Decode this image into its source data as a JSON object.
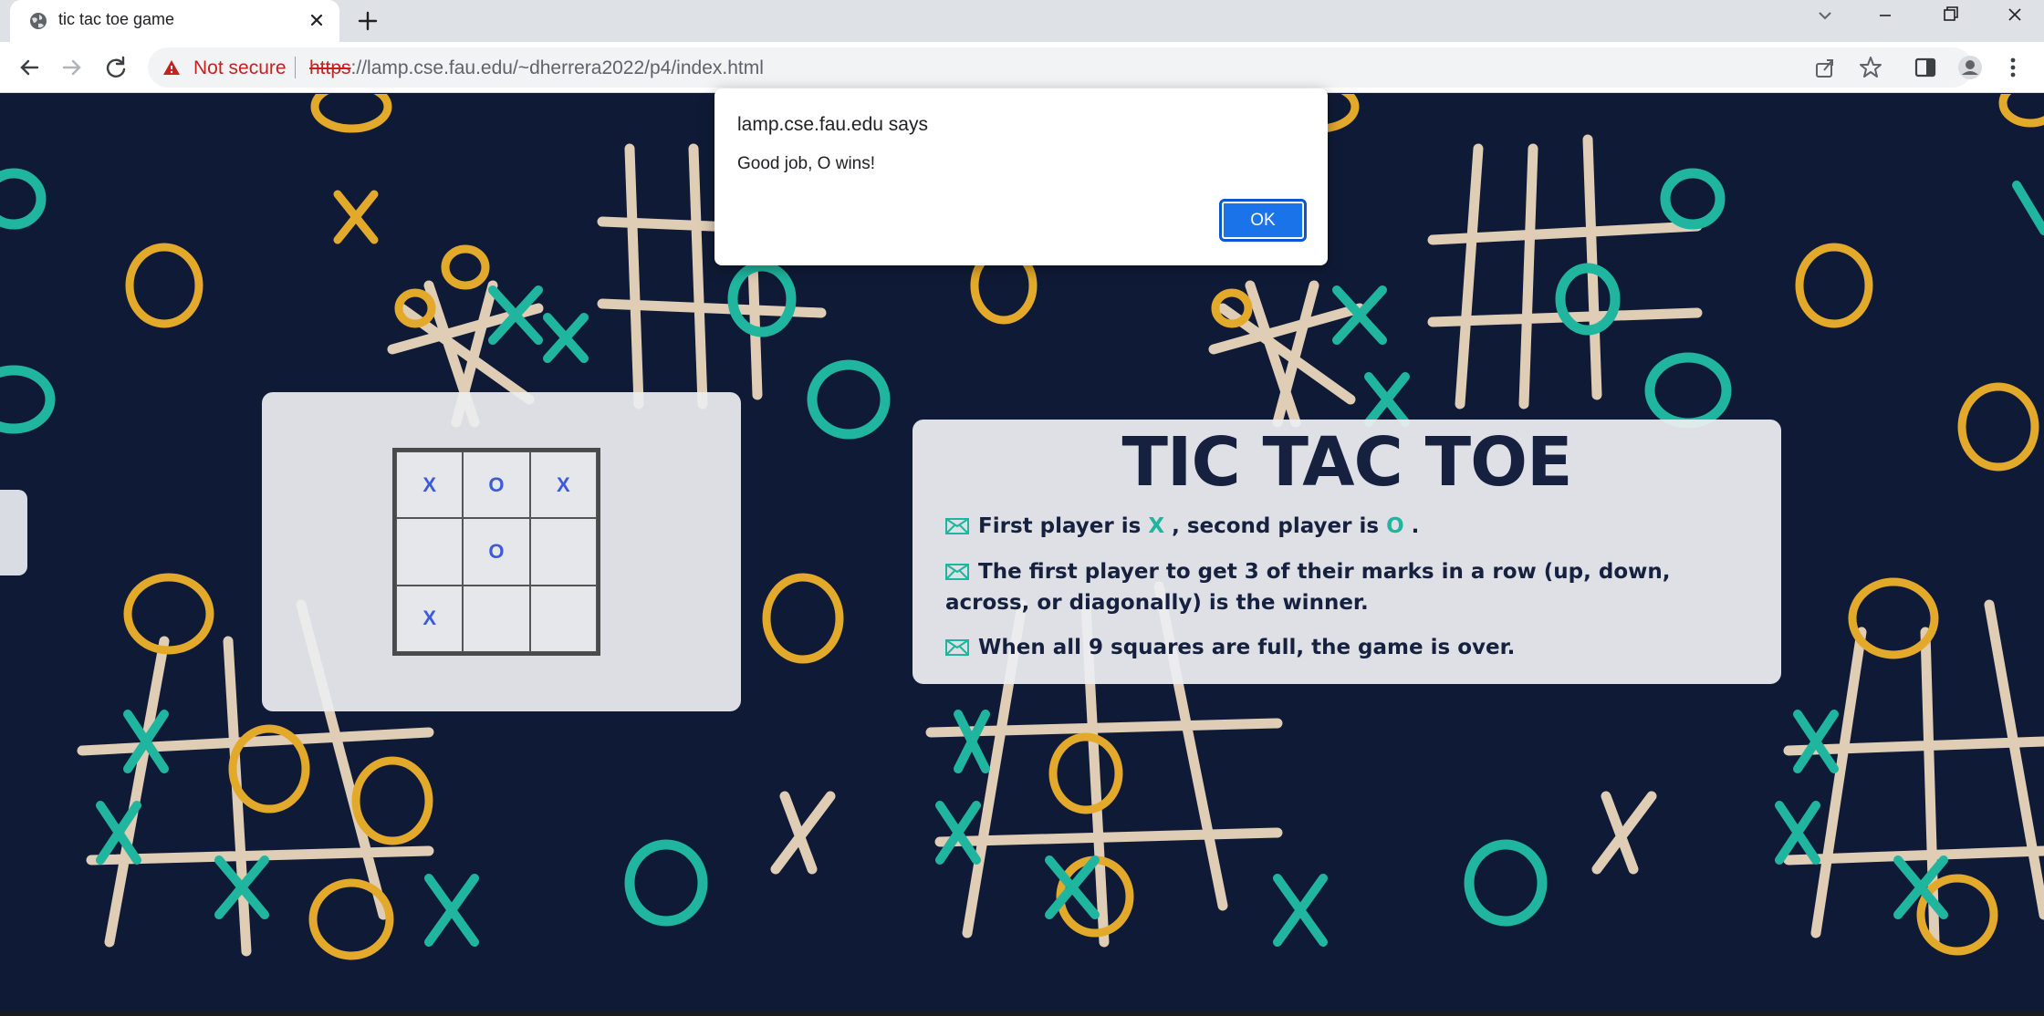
{
  "browser": {
    "tab_title": "tic tac toe game",
    "url_scheme": "https",
    "url_rest": "://lamp.cse.fau.edu/~dherrera2022/p4/index.html",
    "security_label": "Not secure",
    "accent": "#1a73e8",
    "warning_color": "#c5221f"
  },
  "dialog": {
    "title": "lamp.cse.fau.edu says",
    "message": "Good job, O wins!",
    "ok_label": "OK"
  },
  "board": {
    "cells": [
      "X",
      "O",
      "X",
      "",
      "O",
      "",
      "X",
      "",
      ""
    ]
  },
  "rules": {
    "title": "TIC TAC TOE",
    "rule1_prefix": "First player is",
    "rule1_x": "X",
    "rule1_middle": ", second player is",
    "rule1_o": "O",
    "rule1_suffix": ".",
    "rule2": "The first player to get 3 of their marks in a row (up, down, across, or diagonally) is the winner.",
    "rule3": "When all 9 squares are full, the game is over."
  },
  "colors": {
    "background": "#0f1b36",
    "mark_teal": "#1fb59e",
    "mark_gold": "#e3a92a",
    "mark_cream": "#f2dcc0",
    "title_navy": "#16213f",
    "cell_mark": "#3b5bdb"
  }
}
